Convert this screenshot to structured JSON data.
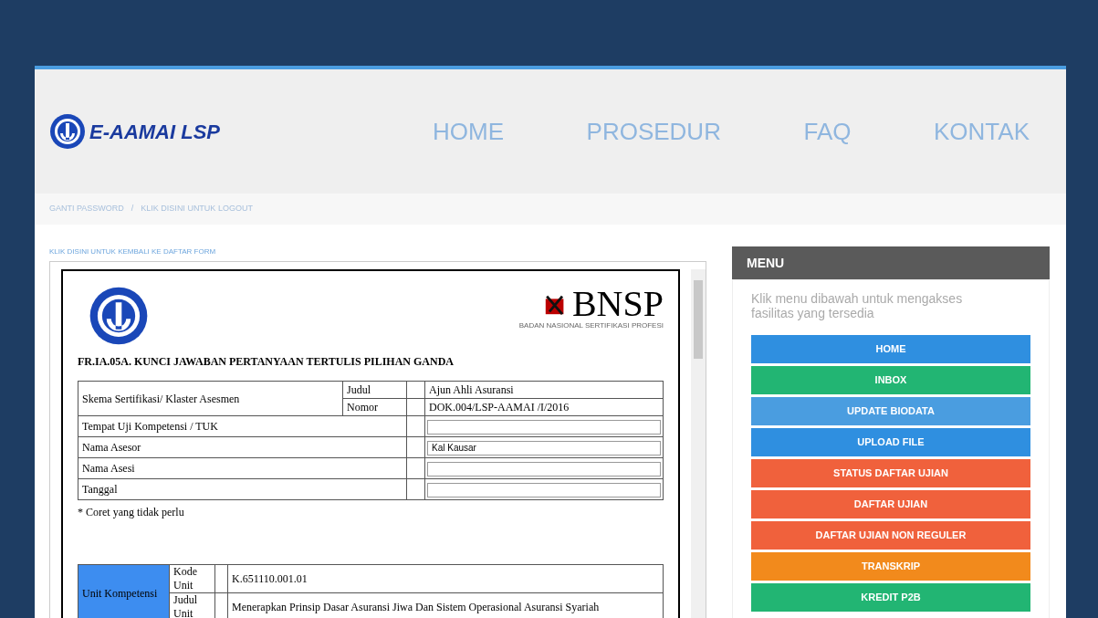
{
  "header": {
    "brand": "E-AAMAI LSP",
    "nav": [
      "HOME",
      "PROSEDUR",
      "FAQ",
      "KONTAK"
    ]
  },
  "breadcrumb": {
    "items": [
      "GANTI PASSWORD",
      "KLIK DISINI UNTUK LOGOUT"
    ],
    "separator": "/"
  },
  "back_link": "KLIK DISINI UNTUK KEMBALI KE DAFTAR FORM",
  "document": {
    "logo_text": "BNSP",
    "logo_caption": "BADAN NASIONAL SERTIFIKASI PROFESI",
    "title": "FR.IA.05A. KUNCI JAWABAN PERTANYAAN TERTULIS PILIHAN GANDA",
    "scheme": {
      "label": "Skema Sertifikasi/ Klaster Asesmen",
      "rows": [
        {
          "label": "Judul",
          "value": "Ajun Ahli Asuransi"
        },
        {
          "label": "Nomor",
          "value": "DOK.004/LSP-AAMAI /I/2016"
        }
      ]
    },
    "fields": [
      {
        "label": "Tempat Uji Kompetensi / TUK"
      },
      {
        "label": "Nama Asesor",
        "value": "Kal Kausar"
      },
      {
        "label": "Nama Asesi"
      },
      {
        "label": "Tanggal"
      }
    ],
    "note": "* Coret yang tidak perlu",
    "unit": {
      "label": "Unit Kompetensi",
      "rows": [
        {
          "label": "Kode Unit",
          "value": "K.651110.001.01"
        },
        {
          "label": "Judul Unit",
          "value": "Menerapkan Prinsip Dasar Asuransi Jiwa Dan Sistem Operasional Asuransi Syariah"
        }
      ]
    }
  },
  "menu": {
    "title": "MENU",
    "intro": "Klik menu dibawah untuk mengakses fasilitas yang tersedia",
    "items": [
      {
        "label": "HOME",
        "color": "#2f8fe0"
      },
      {
        "label": "INBOX",
        "color": "#22b573"
      },
      {
        "label": "UPDATE BIODATA",
        "color": "#4a9de0"
      },
      {
        "label": "UPLOAD FILE",
        "color": "#2f8fe0"
      },
      {
        "label": "STATUS DAFTAR UJIAN",
        "color": "#f0613c"
      },
      {
        "label": "DAFTAR UJIAN",
        "color": "#f0613c"
      },
      {
        "label": "DAFTAR UJIAN NON REGULER",
        "color": "#f0613c"
      },
      {
        "label": "TRANSKRIP",
        "color": "#f28a1c"
      },
      {
        "label": "KREDIT P2B",
        "color": "#22b573"
      }
    ]
  }
}
